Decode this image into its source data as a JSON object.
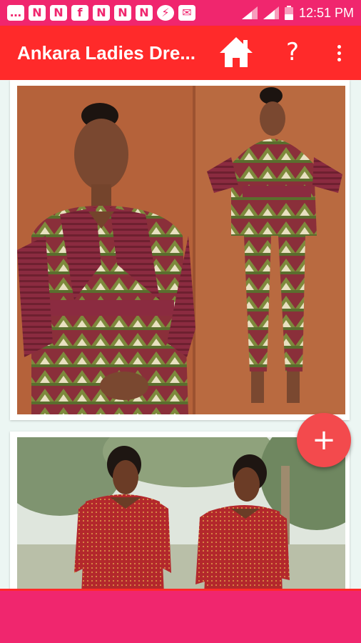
{
  "status_bar": {
    "time": "12:51 PM",
    "notification_icons": [
      "chat-icon",
      "n-icon",
      "n-icon",
      "facebook-icon",
      "n-icon",
      "n-icon",
      "n-icon",
      "messenger-icon",
      "mail-icon"
    ],
    "icon_glyphs": [
      "…",
      "N",
      "N",
      "f",
      "N",
      "N",
      "N",
      "⚡",
      "✉"
    ]
  },
  "app_bar": {
    "title": "Ankara Ladies Dre...",
    "help_label": "?"
  },
  "fab": {
    "label": "+"
  },
  "colors": {
    "status_bar": "#f0266e",
    "app_bar": "#ff2a2a",
    "fab": "#f34a4d",
    "content_bg": "#ecf6f3"
  }
}
